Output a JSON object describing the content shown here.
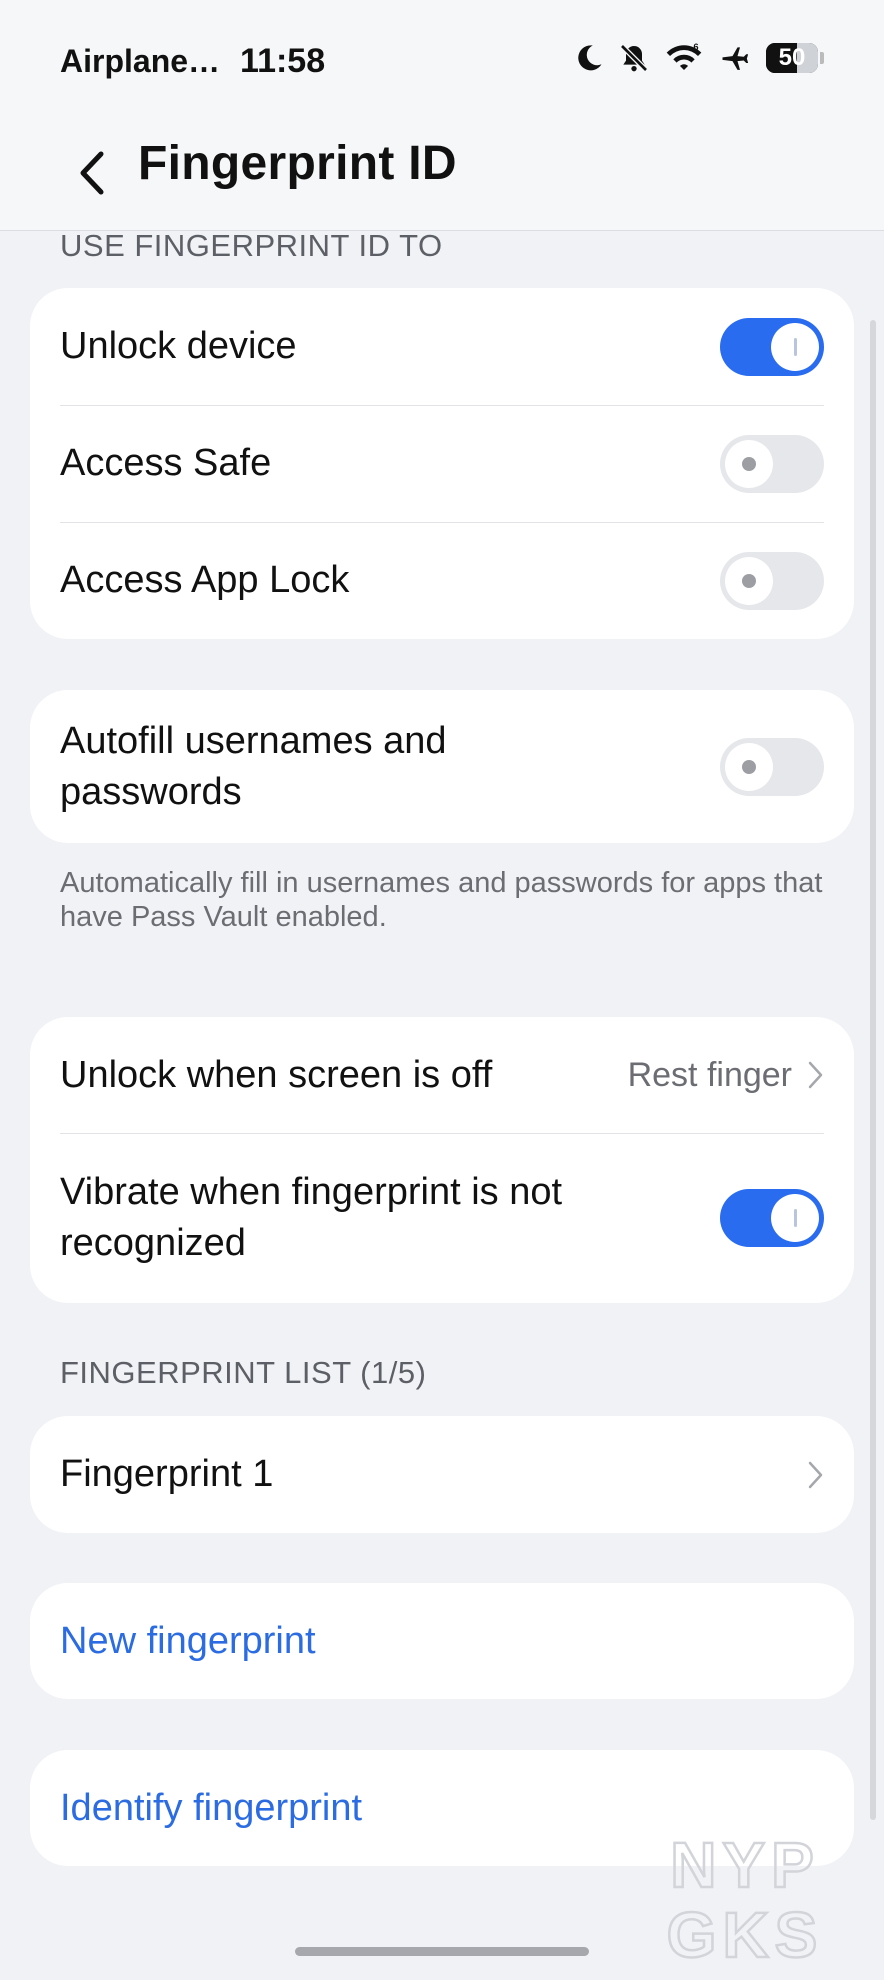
{
  "status_bar": {
    "carrier": "Airplane…",
    "time": "11:58",
    "battery_level": "50",
    "icons": [
      "moon-icon",
      "bell-off-icon",
      "wifi-icon",
      "airplane-icon",
      "battery-icon"
    ]
  },
  "header": {
    "title": "Fingerprint ID"
  },
  "use_section": {
    "label": "USE FINGERPRINT ID TO",
    "items": [
      {
        "label": "Unlock device",
        "toggle": true
      },
      {
        "label": "Access Safe",
        "toggle": false
      },
      {
        "label": "Access App Lock",
        "toggle": false
      }
    ]
  },
  "autofill": {
    "label": "Autofill usernames and passwords",
    "toggle": false,
    "note": "Automatically fill in usernames and passwords for apps that have Pass Vault enabled."
  },
  "screen_section": {
    "unlock_label": "Unlock when screen is off",
    "unlock_value": "Rest finger",
    "vibrate_label": "Vibrate when fingerprint is not recognized",
    "vibrate_toggle": true
  },
  "fingerprint_list": {
    "label": "FINGERPRINT LIST (1/5)",
    "items": [
      {
        "label": "Fingerprint 1"
      }
    ]
  },
  "actions": {
    "new_label": "New fingerprint",
    "identify_label": "Identify fingerprint"
  },
  "watermark": {
    "line1": "NYP",
    "line2": "GKS"
  },
  "colors": {
    "accent": "#2a6cf0",
    "link": "#2b6ce3",
    "background": "#f1f2f6"
  }
}
